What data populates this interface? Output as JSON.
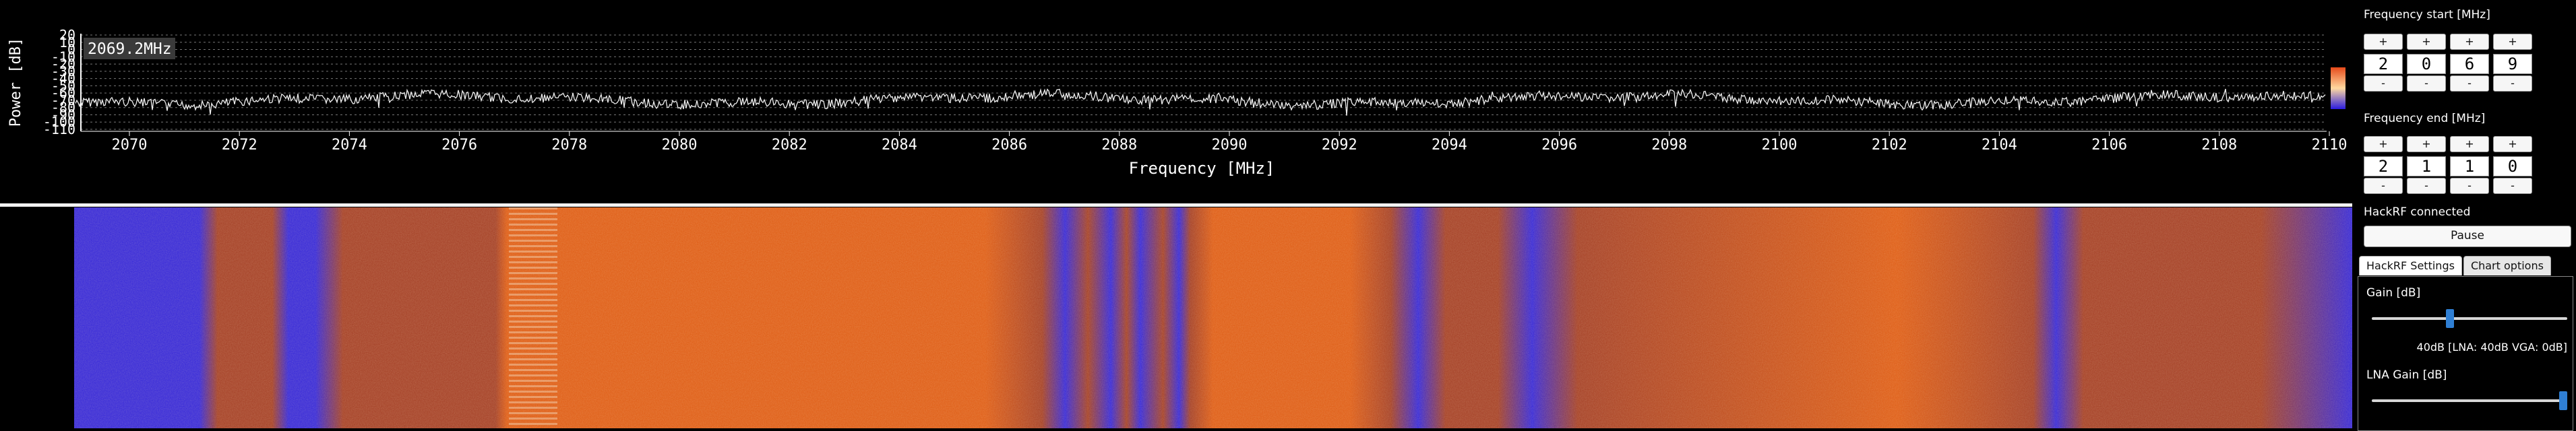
{
  "spectrum": {
    "readout": "2069.2MHz",
    "ylabel": "Power [dB]",
    "xlabel": "Frequency [MHz]",
    "yticks": [
      "20",
      "10",
      "0",
      "-10",
      "-20",
      "-30",
      "-40",
      "-50",
      "-60",
      "-70",
      "-80",
      "-90",
      "-100",
      "-110"
    ],
    "xticks": [
      "2070",
      "2072",
      "2074",
      "2076",
      "2078",
      "2080",
      "2082",
      "2084",
      "2086",
      "2088",
      "2090",
      "2092",
      "2094",
      "2096",
      "2098",
      "2100",
      "2102",
      "2104",
      "2106",
      "2108",
      "2110"
    ],
    "trace_color": "#f0f0f0",
    "gradient_colors": [
      "#e64a1a",
      "#ffd9a0",
      "#2a1be0"
    ]
  },
  "waterfall": {
    "colors": {
      "low": "#3d2fd8",
      "mid": "#a8462c",
      "high": "#e0621c"
    }
  },
  "panel": {
    "freq_start": {
      "title": "Frequency start [MHz]",
      "digits": [
        "2",
        "0",
        "6",
        "9"
      ]
    },
    "freq_end": {
      "title": "Frequency end [MHz]",
      "digits": [
        "2",
        "1",
        "1",
        "0"
      ]
    },
    "plus_label": "+",
    "minus_label": "-",
    "status": "HackRF connected",
    "pause_label": "Pause",
    "tabs": [
      {
        "label": "HackRF Settings"
      },
      {
        "label": "Chart options"
      }
    ],
    "gain": {
      "label": "Gain [dB]",
      "value_text": "40dB [LNA: 40dB VGA: 0dB]",
      "level": 0.4
    },
    "lna_gain": {
      "label": "LNA Gain [dB]",
      "level": 1.0
    }
  }
}
